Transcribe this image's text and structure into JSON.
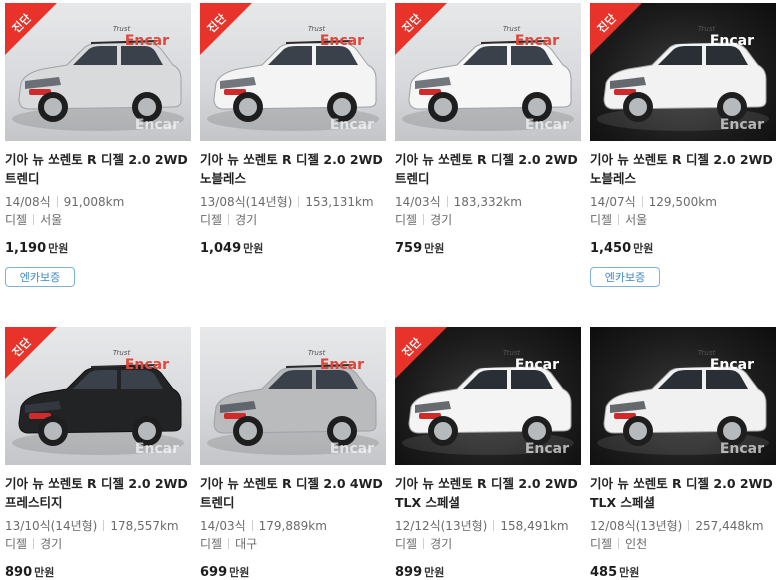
{
  "badge_label": "진단",
  "watermark_label": "Encar",
  "watermark_small": "Trust",
  "price_unit": "만원",
  "listings": [
    {
      "title": "기아 뉴 쏘렌토 R 디젤 2.0 2WD 트렌디",
      "year": "14/08식",
      "mileage": "91,008km",
      "fuel": "디젤",
      "region": "서울",
      "price": "1,190",
      "tag": "엔카보증",
      "diagnosed": true,
      "photo": "light",
      "car_color": "#d9dadc"
    },
    {
      "title": "기아 뉴 쏘렌토 R 디젤 2.0 2WD 노블레스",
      "year": "13/08식(14년형)",
      "mileage": "153,131km",
      "fuel": "디젤",
      "region": "경기",
      "price": "1,049",
      "tag": "",
      "diagnosed": true,
      "photo": "light",
      "car_color": "#f4f4f4"
    },
    {
      "title": "기아 뉴 쏘렌토 R 디젤 2.0 2WD 트렌디",
      "year": "14/03식",
      "mileage": "183,332km",
      "fuel": "디젤",
      "region": "경기",
      "price": "759",
      "tag": "",
      "diagnosed": true,
      "photo": "light",
      "car_color": "#f6f6f6"
    },
    {
      "title": "기아 뉴 쏘렌토 R 디젤 2.0 2WD 노블레스",
      "year": "14/07식",
      "mileage": "129,500km",
      "fuel": "디젤",
      "region": "서울",
      "price": "1,450",
      "tag": "엔카보증",
      "diagnosed": true,
      "photo": "dark",
      "car_color": "#f2f2f2"
    },
    {
      "title": "기아 뉴 쏘렌토 R 디젤 2.0 2WD 프레스티지",
      "year": "13/10식(14년형)",
      "mileage": "178,557km",
      "fuel": "디젤",
      "region": "경기",
      "price": "890",
      "tag": "",
      "diagnosed": true,
      "photo": "light",
      "car_color": "#222325"
    },
    {
      "title": "기아 뉴 쏘렌토 R 디젤 2.0 4WD 트렌디",
      "year": "14/03식",
      "mileage": "179,889km",
      "fuel": "디젤",
      "region": "대구",
      "price": "699",
      "tag": "",
      "diagnosed": false,
      "photo": "light",
      "car_color": "#b9bbbd"
    },
    {
      "title": "기아 뉴 쏘렌토 R 디젤 2.0 2WD TLX 스페셜",
      "year": "12/12식(13년형)",
      "mileage": "158,491km",
      "fuel": "디젤",
      "region": "경기",
      "price": "899",
      "tag": "",
      "diagnosed": true,
      "photo": "dark",
      "car_color": "#f4f4f4"
    },
    {
      "title": "기아 뉴 쏘렌토 R 디젤 2.0 2WD TLX 스페셜",
      "year": "12/08식(13년형)",
      "mileage": "257,448km",
      "fuel": "디젤",
      "region": "인천",
      "price": "485",
      "tag": "",
      "diagnosed": false,
      "photo": "dark",
      "car_color": "#f1f1f1"
    }
  ]
}
